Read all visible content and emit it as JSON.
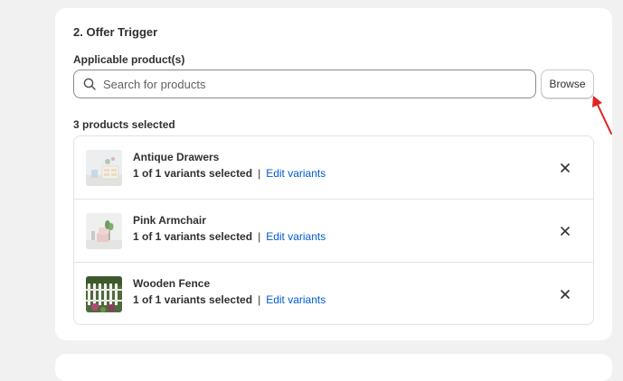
{
  "offer_trigger": {
    "section_title": "2. Offer Trigger",
    "field_label": "Applicable product(s)",
    "search_placeholder": "Search for products",
    "browse_label": "Browse",
    "selected_count_text": "3 products selected",
    "products": [
      {
        "name": "Antique Drawers",
        "variants_text": "1 of 1 variants selected",
        "separator": "|",
        "edit_label": "Edit variants",
        "remove_symbol": "✕"
      },
      {
        "name": "Pink Armchair",
        "variants_text": "1 of 1 variants selected",
        "separator": "|",
        "edit_label": "Edit variants",
        "remove_symbol": "✕"
      },
      {
        "name": "Wooden Fence",
        "variants_text": "1 of 1 variants selected",
        "separator": "|",
        "edit_label": "Edit variants",
        "remove_symbol": "✕"
      }
    ]
  },
  "colors": {
    "link": "#005bd3",
    "annotation_arrow": "#e02424"
  },
  "icons": {
    "search": "search-icon",
    "remove": "close-icon",
    "annotation": "red-arrow-annotation"
  }
}
